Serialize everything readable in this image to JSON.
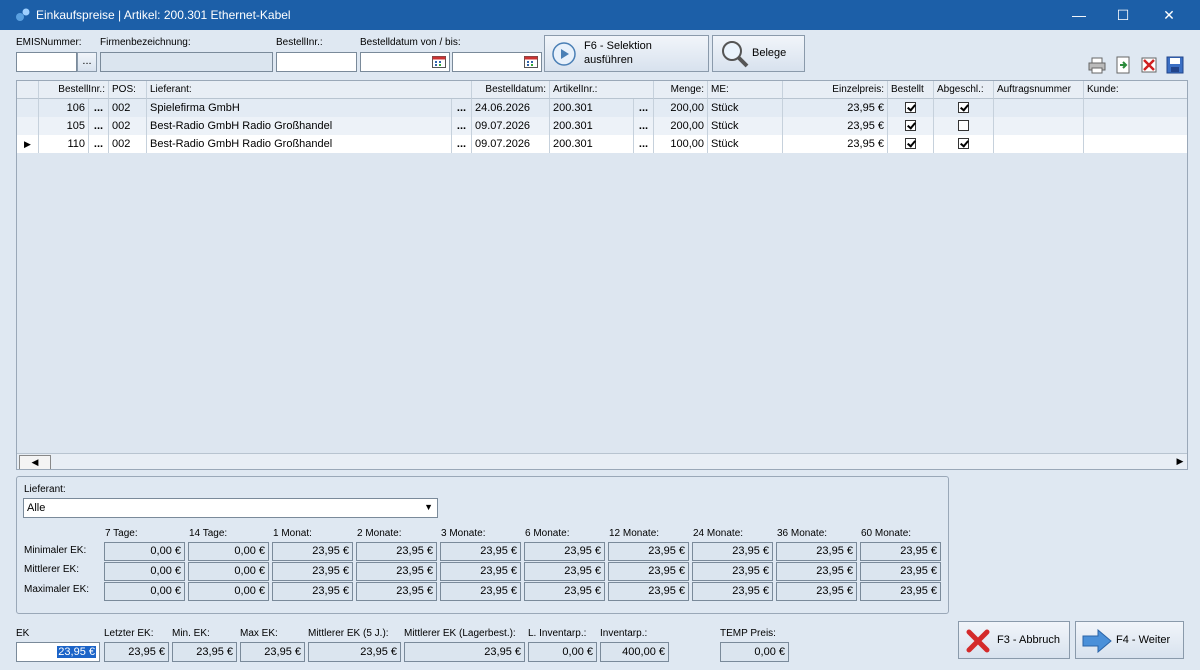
{
  "window": {
    "title": "Einkaufspreise | Artikel: 200.301 Ethernet-Kabel",
    "min": "—",
    "max": "☐",
    "close": "✕"
  },
  "filters": {
    "emis_label": "EMISNummer:",
    "emis_btn": "...",
    "firm_label": "Firmenbezeichnung:",
    "bestell_label": "BestellInr.:",
    "datum_label": "Bestelldatum von / bis:",
    "selektion_btn": "F6 - Selektion\nausführen",
    "selektion_l1": "F6 - Selektion",
    "selektion_l2": "ausführen",
    "belege_btn": "Belege"
  },
  "grid": {
    "headers": [
      "BestellInr.:",
      "POS:",
      "Lieferant:",
      "Bestelldatum:",
      "ArtikelInr.:",
      "Menge:",
      "ME:",
      "Einzelpreis:",
      "Bestellt",
      "Abgeschl.:",
      "Auftragsnummer",
      "Kunde:"
    ],
    "rows": [
      {
        "nr": "106",
        "dots1": "...",
        "pos": "002",
        "lieferant": "Spielefirma GmbH",
        "dots2": "...",
        "datum": "24.06.2026",
        "artikel": "200.301",
        "dots3": "...",
        "menge": "200,00",
        "me": "Stück",
        "preis": "23,95 €",
        "bestellt": true,
        "abgeschl": true
      },
      {
        "nr": "105",
        "dots1": "...",
        "pos": "002",
        "lieferant": "Best-Radio GmbH Radio Großhandel",
        "dots2": "...",
        "datum": "09.07.2026",
        "artikel": "200.301",
        "dots3": "...",
        "menge": "200,00",
        "me": "Stück",
        "preis": "23,95 €",
        "bestellt": true,
        "abgeschl": false
      },
      {
        "nr": "110",
        "dots1": "...",
        "pos": "002",
        "lieferant": "Best-Radio GmbH Radio Großhandel",
        "dots2": "...",
        "datum": "09.07.2026",
        "artikel": "200.301",
        "dots3": "...",
        "menge": "100,00",
        "me": "Stück",
        "preis": "23,95 €",
        "bestellt": true,
        "abgeschl": true
      }
    ]
  },
  "stats": {
    "lieferant_label": "Lieferant:",
    "lieferant_value": "Alle",
    "periods": [
      "7 Tage:",
      "14 Tage:",
      "1 Monat:",
      "2 Monate:",
      "3 Monate:",
      "6 Monate:",
      "12 Monate:",
      "24 Monate:",
      "36 Monate:",
      "60 Monate:"
    ],
    "row_labels": [
      "Minimaler EK:",
      "Mittlerer EK:",
      "Maximaler EK:"
    ],
    "values": [
      [
        "0,00 €",
        "0,00 €",
        "23,95 €",
        "23,95 €",
        "23,95 €",
        "23,95 €",
        "23,95 €",
        "23,95 €",
        "23,95 €",
        "23,95 €"
      ],
      [
        "0,00 €",
        "0,00 €",
        "23,95 €",
        "23,95 €",
        "23,95 €",
        "23,95 €",
        "23,95 €",
        "23,95 €",
        "23,95 €",
        "23,95 €"
      ],
      [
        "0,00 €",
        "0,00 €",
        "23,95 €",
        "23,95 €",
        "23,95 €",
        "23,95 €",
        "23,95 €",
        "23,95 €",
        "23,95 €",
        "23,95 €"
      ]
    ]
  },
  "bottom": {
    "ek_label": "EK",
    "ek": "23,95 €",
    "letzter_label": "Letzter EK:",
    "letzter": "23,95 €",
    "min_label": "Min. EK:",
    "min": "23,95 €",
    "max_label": "Max EK:",
    "max": "23,95 €",
    "mittel5_label": "Mittlerer EK (5 J.):",
    "mittel5": "23,95 €",
    "mittellager_label": "Mittlerer EK (Lagerbest.):",
    "mittellager": "23,95 €",
    "linv_label": "L. Inventarp.:",
    "linv": "0,00 €",
    "inv_label": "Inventarp.:",
    "inv": "400,00 €",
    "temp_label": "TEMP Preis:",
    "temp": "0,00 €",
    "abbruch_btn": "F3 - Abbruch",
    "weiter_btn": "F4 - Weiter"
  }
}
